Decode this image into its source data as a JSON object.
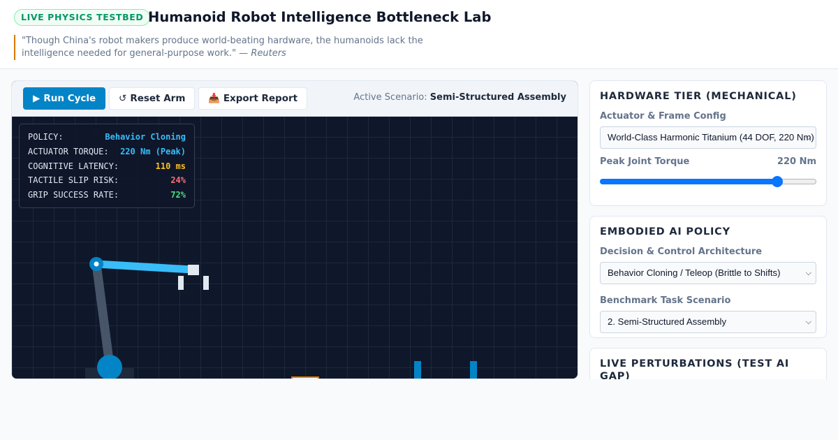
{
  "header": {
    "badge": "LIVE PHYSICS TESTBED",
    "title": "Humanoid Robot Intelligence Bottleneck Lab",
    "quote": "\"Though China's robot makers produce world-beating hardware, the humanoids lack the intelligence needed for general-purpose work.\" —",
    "quote_source": "Reuters"
  },
  "toolbar": {
    "run_label": "Run Cycle",
    "run_icon": "▶",
    "reset_label": "Reset Arm",
    "reset_icon": "↺",
    "export_label": "Export Report",
    "export_icon": "📥",
    "scenario_prefix": "Active Scenario:",
    "scenario_value": "Semi-Structured Assembly"
  },
  "hud": {
    "rows": [
      {
        "key": "POLICY:",
        "value": "Behavior Cloning",
        "color": "#38bdf8"
      },
      {
        "key": "ACTUATOR TORQUE:",
        "value": "220 Nm (Peak)",
        "color": "#38bdf8"
      },
      {
        "key": "COGNITIVE LATENCY:",
        "value": "110 ms",
        "color": "#fbbf24"
      },
      {
        "key": "TACTILE SLIP RISK:",
        "value": "24%",
        "color": "#f87171"
      },
      {
        "key": "GRIP SUCCESS RATE:",
        "value": "72%",
        "color": "#4ade80"
      }
    ]
  },
  "hardware": {
    "heading": "HARDWARE TIER (MECHANICAL)",
    "config_label": "Actuator & Frame Config",
    "config_value": "World-Class Harmonic Titanium (44 DOF, 220 Nm)",
    "torque_label": "Peak Joint Torque",
    "torque_value": "220 Nm",
    "torque_fraction": 0.82
  },
  "policy": {
    "heading": "EMBODIED AI POLICY",
    "arch_label": "Decision & Control Architecture",
    "arch_value": "Behavior Cloning / Teleop (Brittle to Shifts)",
    "task_label": "Benchmark Task Scenario",
    "task_value": "2. Semi-Structured Assembly"
  },
  "perturb": {
    "heading": "LIVE PERTURBATIONS (TEST AI GAP)"
  },
  "colors": {
    "accent": "#0284c7",
    "arm": "#38bdf8",
    "arm_base_link": "#475569",
    "joint": "#0284c7",
    "gripper": "#e2e8f0",
    "post": "#0284c7",
    "part": "#d97706"
  }
}
